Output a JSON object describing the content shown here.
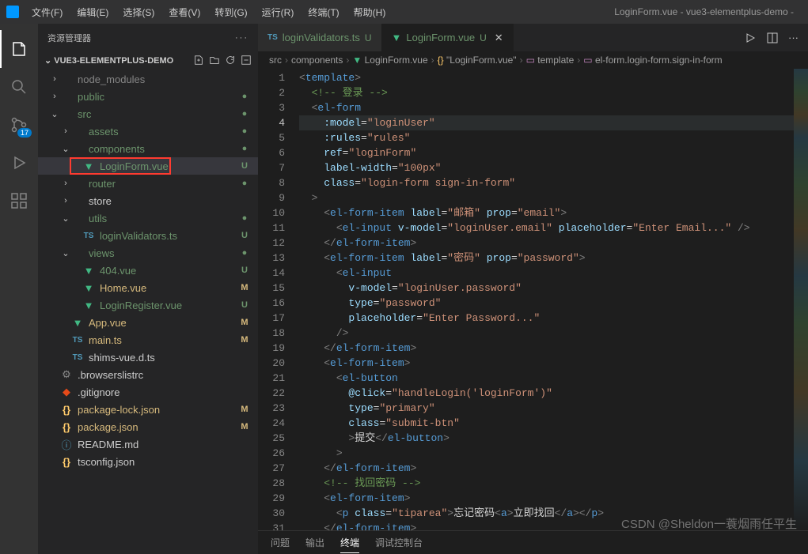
{
  "window_title": "LoginForm.vue - vue3-elementplus-demo -",
  "menu": [
    "文件(F)",
    "编辑(E)",
    "选择(S)",
    "查看(V)",
    "转到(G)",
    "运行(R)",
    "终端(T)",
    "帮助(H)"
  ],
  "activity_badge": "17",
  "sidebar": {
    "header": "资源管理器",
    "project": "VUE3-ELEMENTPLUS-DEMO",
    "items": [
      {
        "label": "node_modules",
        "indent": 1,
        "chev": "›",
        "ic": "",
        "cls": "dim",
        "gs": ""
      },
      {
        "label": "public",
        "indent": 1,
        "chev": "›",
        "ic": "",
        "cls": "green",
        "gs": "dot"
      },
      {
        "label": "src",
        "indent": 1,
        "chev": "⌄",
        "ic": "",
        "cls": "green",
        "gs": "dot"
      },
      {
        "label": "assets",
        "indent": 2,
        "chev": "›",
        "ic": "",
        "cls": "green",
        "gs": "dot"
      },
      {
        "label": "components",
        "indent": 2,
        "chev": "⌄",
        "ic": "",
        "cls": "green",
        "gs": "dot"
      },
      {
        "label": "LoginForm.vue",
        "indent": 3,
        "chev": "",
        "ic": "vue",
        "cls": "green",
        "gs": "U",
        "active": true,
        "boxed": true
      },
      {
        "label": "router",
        "indent": 2,
        "chev": "›",
        "ic": "",
        "cls": "green",
        "gs": "dot"
      },
      {
        "label": "store",
        "indent": 2,
        "chev": "›",
        "ic": "",
        "cls": "",
        "gs": ""
      },
      {
        "label": "utils",
        "indent": 2,
        "chev": "⌄",
        "ic": "",
        "cls": "green",
        "gs": "dot"
      },
      {
        "label": "loginValidators.ts",
        "indent": 3,
        "chev": "",
        "ic": "ts",
        "cls": "green",
        "gs": "U"
      },
      {
        "label": "views",
        "indent": 2,
        "chev": "⌄",
        "ic": "",
        "cls": "green",
        "gs": "dot"
      },
      {
        "label": "404.vue",
        "indent": 3,
        "chev": "",
        "ic": "vue",
        "cls": "green",
        "gs": "U"
      },
      {
        "label": "Home.vue",
        "indent": 3,
        "chev": "",
        "ic": "vue",
        "cls": "yellow",
        "gs": "M"
      },
      {
        "label": "LoginRegister.vue",
        "indent": 3,
        "chev": "",
        "ic": "vue",
        "cls": "green",
        "gs": "U"
      },
      {
        "label": "App.vue",
        "indent": 2,
        "chev": "",
        "ic": "vue",
        "cls": "yellow",
        "gs": "M"
      },
      {
        "label": "main.ts",
        "indent": 2,
        "chev": "",
        "ic": "ts",
        "cls": "yellow",
        "gs": "M"
      },
      {
        "label": "shims-vue.d.ts",
        "indent": 2,
        "chev": "",
        "ic": "ts",
        "cls": "",
        "gs": ""
      },
      {
        "label": ".browserslistrc",
        "indent": 1,
        "chev": "",
        "ic": "gear",
        "cls": "",
        "gs": ""
      },
      {
        "label": ".gitignore",
        "indent": 1,
        "chev": "",
        "ic": "git",
        "cls": "",
        "gs": ""
      },
      {
        "label": "package-lock.json",
        "indent": 1,
        "chev": "",
        "ic": "json",
        "cls": "yellow",
        "gs": "M"
      },
      {
        "label": "package.json",
        "indent": 1,
        "chev": "",
        "ic": "json",
        "cls": "yellow",
        "gs": "M"
      },
      {
        "label": "README.md",
        "indent": 1,
        "chev": "",
        "ic": "readme",
        "cls": "",
        "gs": ""
      },
      {
        "label": "tsconfig.json",
        "indent": 1,
        "chev": "",
        "ic": "json",
        "cls": "",
        "gs": ""
      }
    ]
  },
  "tabs": [
    {
      "icon": "ts",
      "label": "loginValidators.ts",
      "status": "U",
      "active": false
    },
    {
      "icon": "vue",
      "label": "LoginForm.vue",
      "status": "U",
      "active": true,
      "close": true
    }
  ],
  "breadcrumb": [
    "src",
    "components",
    "LoginForm.vue",
    "\"LoginForm.vue\"",
    "template",
    "el-form.login-form.sign-in-form"
  ],
  "code_lines": [
    {
      "n": 1,
      "html": "<span class='c-gray'>&lt;</span><span class='c-tag'>template</span><span class='c-gray'>&gt;</span>"
    },
    {
      "n": 2,
      "html": "  <span class='c-green'>&lt;!-- 登录 --&gt;</span>"
    },
    {
      "n": 3,
      "html": "  <span class='c-gray'>&lt;</span><span class='c-tag'>el-form</span>"
    },
    {
      "n": 4,
      "hl": true,
      "html": "    <span class='c-attr'>:model</span><span class='c-eq'>=</span><span class='c-str'>\"loginUser\"</span>"
    },
    {
      "n": 5,
      "html": "    <span class='c-attr'>:rules</span><span class='c-eq'>=</span><span class='c-str'>\"rules\"</span>"
    },
    {
      "n": 6,
      "html": "    <span class='c-attr'>ref</span><span class='c-eq'>=</span><span class='c-str'>\"loginForm\"</span>"
    },
    {
      "n": 7,
      "html": "    <span class='c-attr'>label-width</span><span class='c-eq'>=</span><span class='c-str'>\"100px\"</span>"
    },
    {
      "n": 8,
      "html": "    <span class='c-attr'>class</span><span class='c-eq'>=</span><span class='c-str'>\"login-form sign-in-form\"</span>"
    },
    {
      "n": 9,
      "html": "  <span class='c-gray'>&gt;</span>"
    },
    {
      "n": 10,
      "html": "    <span class='c-gray'>&lt;</span><span class='c-tag'>el-form-item</span> <span class='c-attr'>label</span><span class='c-eq'>=</span><span class='c-str'>\"邮箱\"</span> <span class='c-attr'>prop</span><span class='c-eq'>=</span><span class='c-str'>\"email\"</span><span class='c-gray'>&gt;</span>"
    },
    {
      "n": 11,
      "html": "      <span class='c-gray'>&lt;</span><span class='c-tag'>el-input</span> <span class='c-attr'>v-model</span><span class='c-eq'>=</span><span class='c-str'>\"loginUser.email\"</span> <span class='c-attr'>placeholder</span><span class='c-eq'>=</span><span class='c-str'>\"Enter Email...\"</span> <span class='c-gray'>/&gt;</span>"
    },
    {
      "n": 12,
      "html": "    <span class='c-gray'>&lt;/</span><span class='c-tag'>el-form-item</span><span class='c-gray'>&gt;</span>"
    },
    {
      "n": 13,
      "html": "    <span class='c-gray'>&lt;</span><span class='c-tag'>el-form-item</span> <span class='c-attr'>label</span><span class='c-eq'>=</span><span class='c-str'>\"密码\"</span> <span class='c-attr'>prop</span><span class='c-eq'>=</span><span class='c-str'>\"password\"</span><span class='c-gray'>&gt;</span>"
    },
    {
      "n": 14,
      "html": "      <span class='c-gray'>&lt;</span><span class='c-tag'>el-input</span>"
    },
    {
      "n": 15,
      "html": "        <span class='c-attr'>v-model</span><span class='c-eq'>=</span><span class='c-str'>\"loginUser.password\"</span>"
    },
    {
      "n": 16,
      "html": "        <span class='c-attr'>type</span><span class='c-eq'>=</span><span class='c-str'>\"password\"</span>"
    },
    {
      "n": 17,
      "html": "        <span class='c-attr'>placeholder</span><span class='c-eq'>=</span><span class='c-str'>\"Enter Password...\"</span>"
    },
    {
      "n": 18,
      "html": "      <span class='c-gray'>/&gt;</span>"
    },
    {
      "n": 19,
      "html": "    <span class='c-gray'>&lt;/</span><span class='c-tag'>el-form-item</span><span class='c-gray'>&gt;</span>"
    },
    {
      "n": 20,
      "html": "    <span class='c-gray'>&lt;</span><span class='c-tag'>el-form-item</span><span class='c-gray'>&gt;</span>"
    },
    {
      "n": 21,
      "html": "      <span class='c-gray'>&lt;</span><span class='c-tag'>el-button</span>"
    },
    {
      "n": 22,
      "html": "        <span class='c-attr'>@click</span><span class='c-eq'>=</span><span class='c-str'>\"handleLogin('loginForm')\"</span>"
    },
    {
      "n": 23,
      "html": "        <span class='c-attr'>type</span><span class='c-eq'>=</span><span class='c-str'>\"primary\"</span>"
    },
    {
      "n": 24,
      "html": "        <span class='c-attr'>class</span><span class='c-eq'>=</span><span class='c-str'>\"submit-btn\"</span>"
    },
    {
      "n": 25,
      "html": "        <span class='c-gray'>&gt;</span><span class='c-text'>提交</span><span class='c-gray'>&lt;/</span><span class='c-tag'>el-button</span><span class='c-gray'>&gt;</span>"
    },
    {
      "n": 26,
      "html": "      <span class='c-gray'>&gt;</span>"
    },
    {
      "n": 27,
      "html": "    <span class='c-gray'>&lt;/</span><span class='c-tag'>el-form-item</span><span class='c-gray'>&gt;</span>"
    },
    {
      "n": 28,
      "html": "    <span class='c-green'>&lt;!-- 找回密码 --&gt;</span>"
    },
    {
      "n": 29,
      "html": "    <span class='c-gray'>&lt;</span><span class='c-tag'>el-form-item</span><span class='c-gray'>&gt;</span>"
    },
    {
      "n": 30,
      "html": "      <span class='c-gray'>&lt;</span><span class='c-tag'>p</span> <span class='c-attr'>class</span><span class='c-eq'>=</span><span class='c-str'>\"tiparea\"</span><span class='c-gray'>&gt;</span><span class='c-text'>忘记密码</span><span class='c-gray'>&lt;</span><span class='c-tag'>a</span><span class='c-gray'>&gt;</span><span class='c-text'>立即找回</span><span class='c-gray'>&lt;/</span><span class='c-tag'>a</span><span class='c-gray'>&gt;&lt;/</span><span class='c-tag'>p</span><span class='c-gray'>&gt;</span>"
    },
    {
      "n": 31,
      "html": "    <span class='c-gray'>&lt;/</span><span class='c-tag'>el-form-item</span><span class='c-gray'>&gt;</span>"
    }
  ],
  "bottom_tabs": [
    "问题",
    "输出",
    "终端",
    "调试控制台"
  ],
  "bottom_active": 2,
  "watermark": "CSDN @Sheldon一蓑烟雨任平生"
}
